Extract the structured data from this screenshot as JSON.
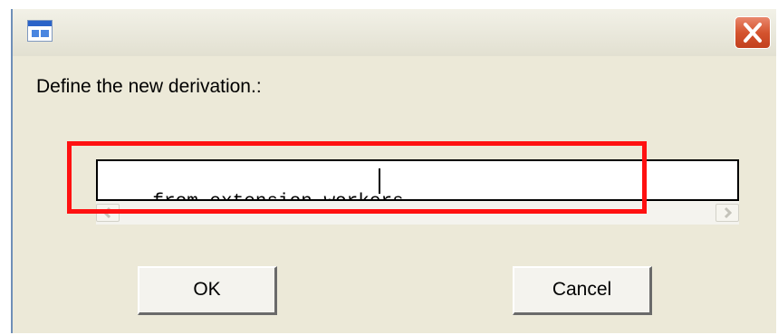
{
  "dialog": {
    "title": "",
    "icon": "app-window-icon",
    "close_icon": "close-icon",
    "prompt_label": "Define the new derivation.:",
    "input_value": "from extension workers",
    "scroll_left_icon": "scroll-left-arrow-icon",
    "scroll_right_icon": "scroll-right-arrow-icon",
    "ok_label": "OK",
    "cancel_label": "Cancel"
  },
  "colors": {
    "dialog_background": "#ece9d8",
    "close_button": "#d5542f",
    "highlight": "#ff1111"
  }
}
